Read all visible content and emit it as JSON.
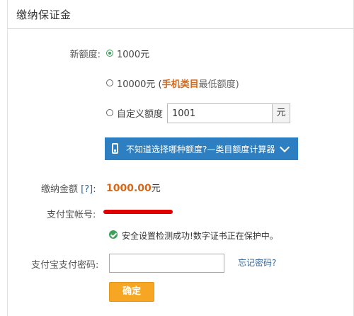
{
  "header": {
    "title": "缴纳保证金"
  },
  "form": {
    "new_quota_label": "新额度:",
    "options": [
      {
        "label": "1000元",
        "selected": true
      },
      {
        "label_prefix": "10000元 (",
        "highlight": "手机类目",
        "label_suffix": "最低额度)",
        "selected": false
      },
      {
        "label": "自定义额度",
        "selected": false
      }
    ],
    "custom_amount_value": "1001",
    "custom_amount_unit": "元",
    "calculator_text": "不知道选择哪种额度?—类目额度计算器",
    "pay_amount_label": "缴纳金额",
    "help_link": "[?]",
    "pay_amount_suffix": ":",
    "pay_amount_value": "1000.00",
    "pay_amount_unit": "元",
    "alipay_account_label": "支付宝帐号:",
    "security_message": "安全设置检测成功!数字证书正在保护中。",
    "password_label": "支付宝支付密码:",
    "forgot_password": "忘记密码?",
    "confirm_button": "确定"
  },
  "colors": {
    "accent_orange": "#d2691e",
    "calc_bar_blue": "#2d7fc1",
    "confirm_button": "#f6a623",
    "success_green": "#3aa05a",
    "redaction_red": "#e00000"
  },
  "icons": [
    "radio-checked-icon",
    "phone-icon",
    "chevron-down-icon",
    "check-circle-icon"
  ]
}
